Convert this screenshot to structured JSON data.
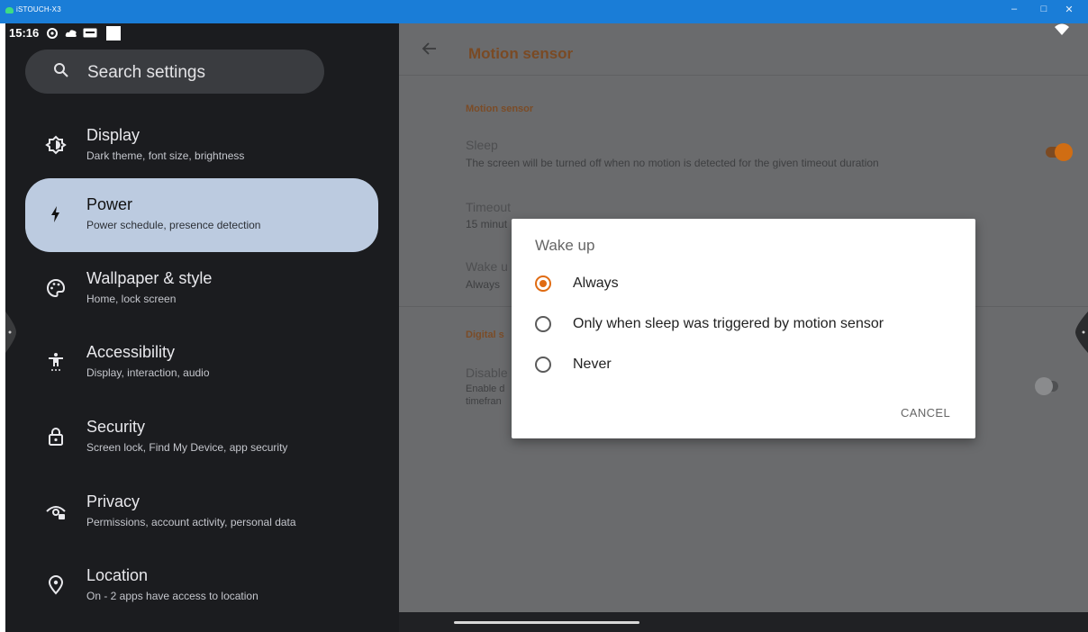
{
  "window": {
    "title": "iSTOUCH-X3",
    "minimize": "–",
    "maximize": "□",
    "close": "✕"
  },
  "status": {
    "time": "15:16"
  },
  "search": {
    "placeholder": "Search settings"
  },
  "sidebar": {
    "items": [
      {
        "title": "Display",
        "subtitle": "Dark theme, font size, brightness",
        "icon": "display-icon"
      },
      {
        "title": "Power",
        "subtitle": "Power schedule, presence detection",
        "icon": "bolt-icon",
        "active": true
      },
      {
        "title": "Wallpaper & style",
        "subtitle": "Home, lock screen",
        "icon": "palette-icon"
      },
      {
        "title": "Accessibility",
        "subtitle": "Display, interaction, audio",
        "icon": "accessibility-icon"
      },
      {
        "title": "Security",
        "subtitle": "Screen lock, Find My Device, app security",
        "icon": "lock-icon"
      },
      {
        "title": "Privacy",
        "subtitle": "Permissions, account activity, personal data",
        "icon": "privacy-icon"
      },
      {
        "title": "Location",
        "subtitle": "On - 2 apps have access to location",
        "icon": "location-pin-icon"
      }
    ]
  },
  "page": {
    "title": "Motion sensor",
    "section1": "Motion sensor",
    "sleep": {
      "title": "Sleep",
      "summary": "The screen will be turned off when no motion is detected for the given timeout duration",
      "enabled": true
    },
    "timeout": {
      "title": "Timeout",
      "summary": "15 minut"
    },
    "wakeup": {
      "title": "Wake u",
      "summary": "Always"
    },
    "section2": "Digital s",
    "disable": {
      "title": "Disable",
      "summary_line1": "Enable d",
      "summary_line2": "timefran",
      "enabled": false
    }
  },
  "dialog": {
    "title": "Wake up",
    "options": [
      {
        "label": "Always",
        "selected": true
      },
      {
        "label": "Only when sleep was triggered by motion sensor",
        "selected": false
      },
      {
        "label": "Never",
        "selected": false
      }
    ],
    "cancel": "CANCEL"
  },
  "colors": {
    "accent": "#e06b12",
    "titlebar": "#1a7dd7",
    "active_item": "#bccbe0"
  }
}
